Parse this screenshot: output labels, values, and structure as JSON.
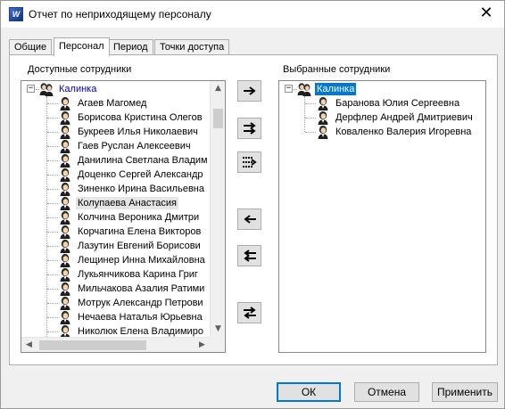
{
  "window": {
    "title": "Отчет по неприходящему персоналу",
    "app_icon": "app-icon",
    "close_glyph": "✕"
  },
  "tabs": [
    {
      "label": "Общие",
      "active": false
    },
    {
      "label": "Персонал",
      "active": true
    },
    {
      "label": "Период",
      "active": false
    },
    {
      "label": "Точки доступа",
      "active": false
    }
  ],
  "available": {
    "label": "Доступные сотрудники",
    "root": "Калинка",
    "items": [
      "Агаев Магомед",
      "Борисова Кристина Олегов",
      "Букреев Илья Николаевич",
      "Гаев Руслан Алексеевич",
      "Данилина Светлана Владим",
      "Доценко Сергей Александр",
      "Зиненко Ирина Васильевна",
      "Колупаева Анастасия",
      "Колчина Вероника Дмитри",
      "Корчагина Елена Викторов",
      "Лазутин Евгений Борисови",
      "Лещинер Инна Михайловна",
      "Лукьянчикова Карина Григ",
      "Мильчакова Азалия Ратими",
      "Мотрук Александр Петрови",
      "Нечаева Наталья Юрьевна",
      "Николюк Елена Владимиро"
    ],
    "highlighted_index": 7
  },
  "selected": {
    "label": "Выбранные сотрудники",
    "root": "Калинка",
    "items": [
      "Баранова Юлия Сергеевна",
      "Дерфлер Андрей Дмитриевич",
      "Коваленко Валерия Игоревна"
    ]
  },
  "move_buttons": [
    {
      "name": "add-selected-button",
      "icon": "arrow-right-icon"
    },
    {
      "name": "add-group-button",
      "icon": "double-arrow-right-icon"
    },
    {
      "name": "add-all-button",
      "icon": "dotted-arrow-right-icon"
    },
    {
      "name": "remove-selected-button",
      "icon": "arrow-left-icon"
    },
    {
      "name": "remove-all-button",
      "icon": "double-arrow-left-icon"
    },
    {
      "name": "swap-button",
      "icon": "swap-arrows-icon"
    }
  ],
  "buttons": {
    "ok": "ОК",
    "cancel": "Отмена",
    "apply": "Применить"
  },
  "scrollbar_glyphs": {
    "up": "▲",
    "down": "▼",
    "left": "◀",
    "right": "▶"
  },
  "colors": {
    "selection": "#0078d7",
    "root_text": "#0000cc"
  }
}
